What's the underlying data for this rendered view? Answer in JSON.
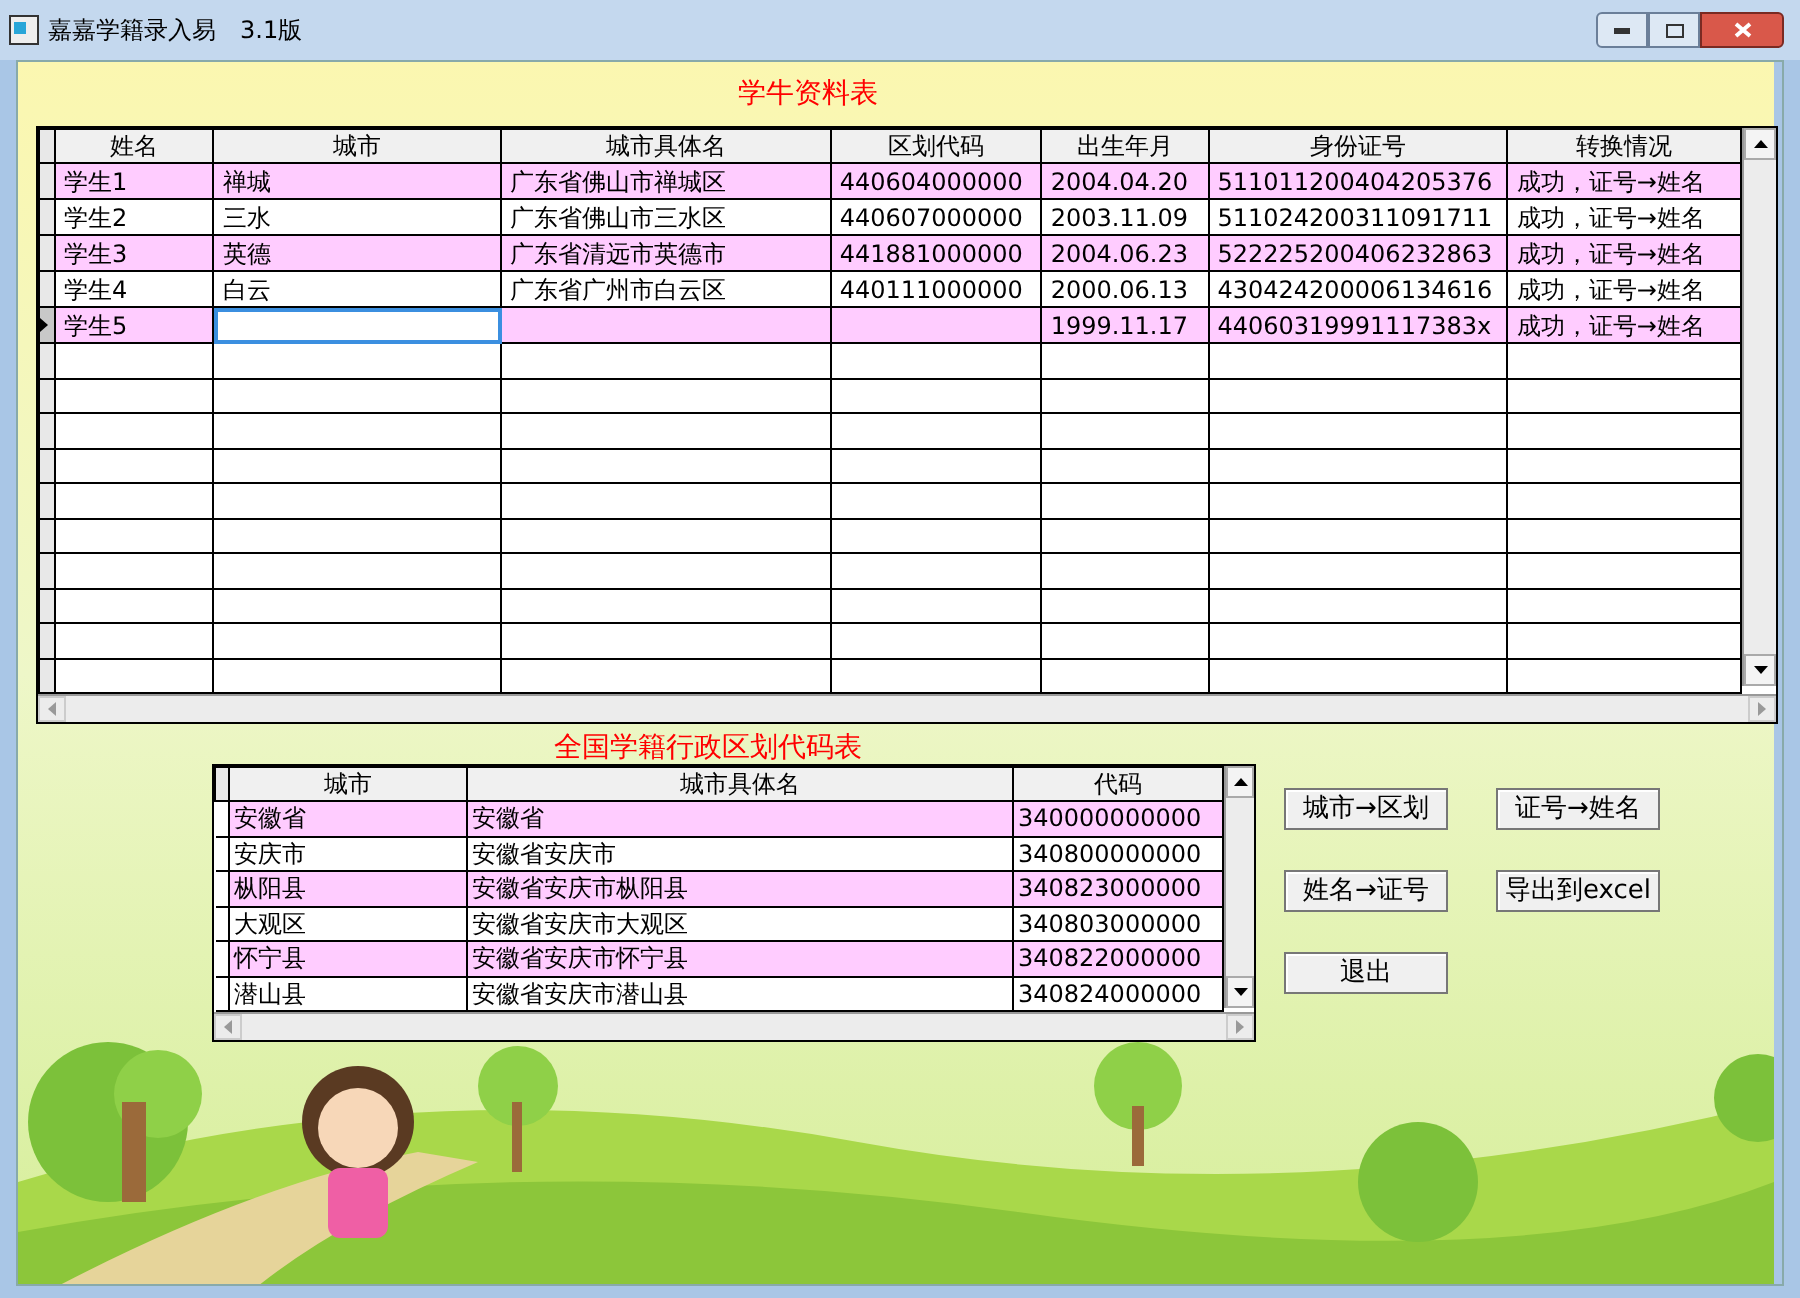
{
  "window": {
    "title": "嘉嘉学籍录入易　3.1版"
  },
  "student_table": {
    "title": "学牛资料表",
    "columns": [
      "姓名",
      "城市",
      "城市具体名",
      "区划代码",
      "出生年月",
      "身份证号",
      "转换情况"
    ],
    "rows": [
      {
        "cells": [
          "学生1",
          "禅城",
          "广东省佛山市禅城区",
          "440604000000",
          "2004.04.20",
          "511011200404205376",
          "成功，证号→姓名"
        ],
        "current": false
      },
      {
        "cells": [
          "学生2",
          "三水",
          "广东省佛山市三水区",
          "440607000000",
          "2003.11.09",
          "511024200311091711",
          "成功，证号→姓名"
        ],
        "current": false
      },
      {
        "cells": [
          "学生3",
          "英德",
          "广东省清远市英德市",
          "441881000000",
          "2004.06.23",
          "522225200406232863",
          "成功，证号→姓名"
        ],
        "current": false
      },
      {
        "cells": [
          "学生4",
          "白云",
          "广东省广州市白云区",
          "440111000000",
          "2000.06.13",
          "430424200006134616",
          "成功，证号→姓名"
        ],
        "current": false
      },
      {
        "cells": [
          "学生5",
          "",
          "",
          "",
          "1999.11.17",
          "44060319991117383x",
          "成功，证号→姓名"
        ],
        "current": true
      }
    ]
  },
  "code_table": {
    "title": "全国学籍行政区划代码表",
    "columns": [
      "城市",
      "城市具体名",
      "代码"
    ],
    "rows": [
      {
        "cells": [
          "安徽省",
          "安徽省",
          "340000000000"
        ]
      },
      {
        "cells": [
          "安庆市",
          "安徽省安庆市",
          "340800000000"
        ]
      },
      {
        "cells": [
          "枞阳县",
          "安徽省安庆市枞阳县",
          "340823000000"
        ]
      },
      {
        "cells": [
          "大观区",
          "安徽省安庆市大观区",
          "340803000000"
        ]
      },
      {
        "cells": [
          "怀宁县",
          "安徽省安庆市怀宁县",
          "340822000000"
        ]
      },
      {
        "cells": [
          "潜山县",
          "安徽省安庆市潜山县",
          "340824000000"
        ]
      }
    ]
  },
  "buttons": [
    {
      "label": "城市→区划"
    },
    {
      "label": "证号→姓名"
    },
    {
      "label": "姓名→证号"
    },
    {
      "label": "导出到excel"
    },
    {
      "label": "退出"
    }
  ]
}
